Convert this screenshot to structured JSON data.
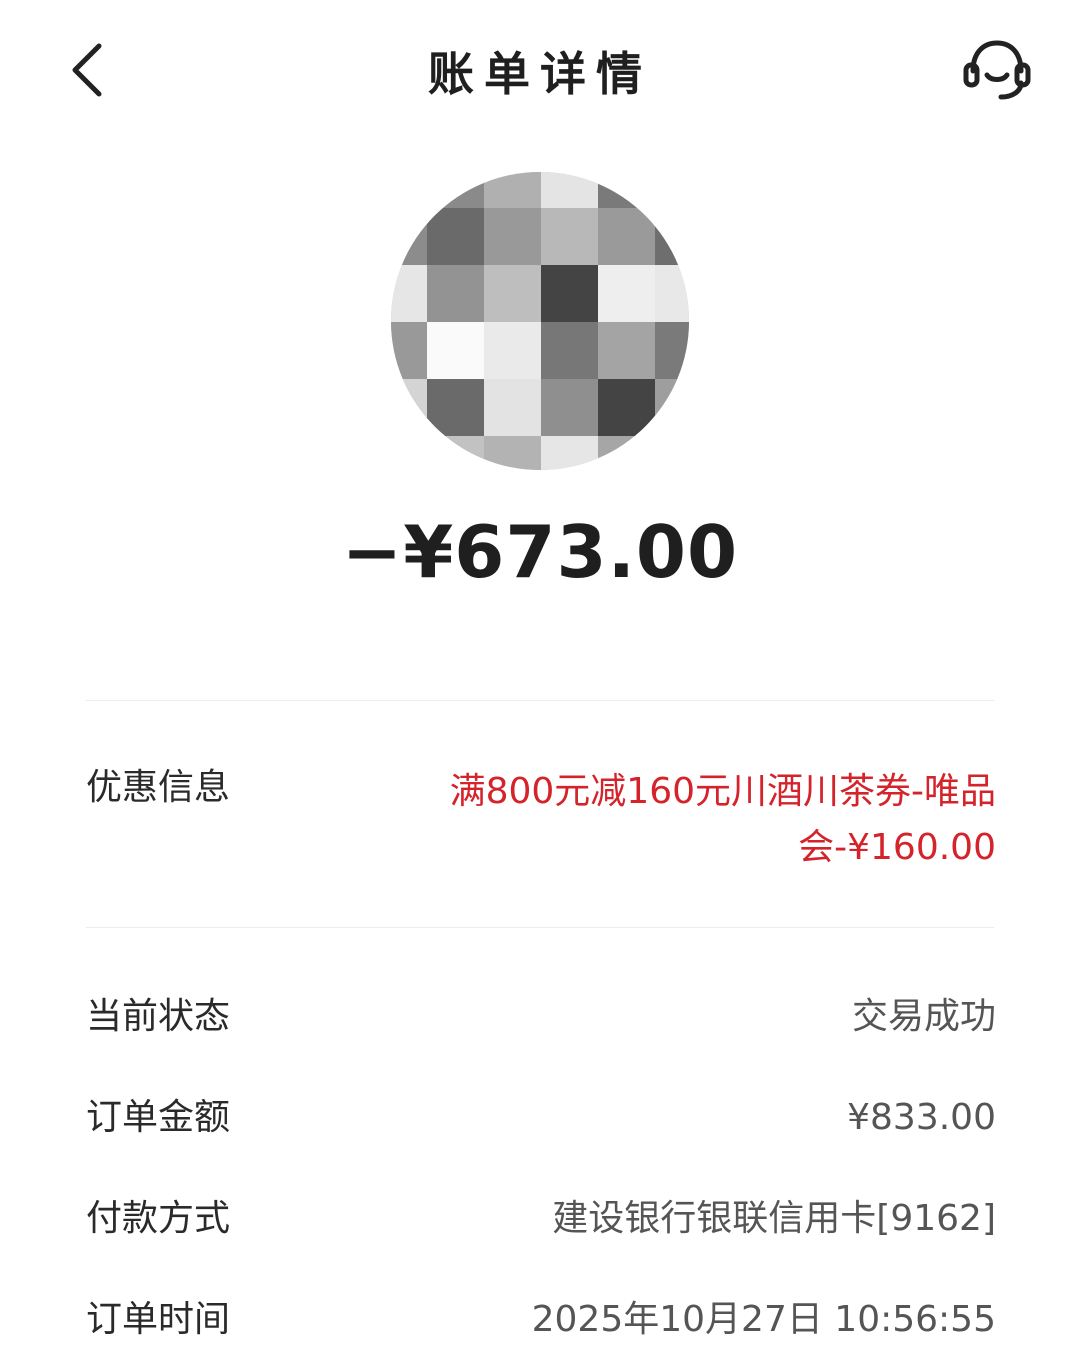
{
  "header": {
    "title": "账单详情",
    "back_icon": "chevron-left-icon",
    "service_icon": "customer-service-headset-icon"
  },
  "summary": {
    "amount": "−¥673.00"
  },
  "discount": {
    "label": "优惠信息",
    "value_line1": "满800元减160元川酒川茶券-唯品",
    "value_line2": "会-¥160.00",
    "color": "#d4232b"
  },
  "details": {
    "status": {
      "label": "当前状态",
      "value": "交易成功"
    },
    "order_amount": {
      "label": "订单金额",
      "value": "¥833.00"
    },
    "payment_method": {
      "label": "付款方式",
      "value": "建设银行银联信用卡[9162]"
    },
    "order_time": {
      "label": "订单时间",
      "value": "2025年10月27日 10:56:55"
    }
  }
}
